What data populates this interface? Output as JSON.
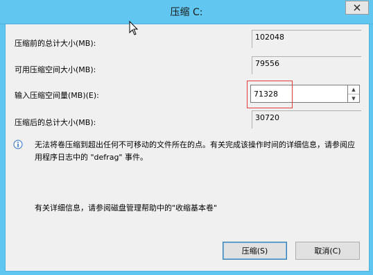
{
  "window": {
    "title": "压缩 C:"
  },
  "fields": {
    "total_before_label": "压缩前的总计大小(MB):",
    "total_before_value": "102048",
    "available_label": "可用压缩空间大小(MB):",
    "available_value": "79556",
    "amount_label": "输入压缩空间量(MB)(E):",
    "amount_value": "71328",
    "total_after_label": "压缩后的总计大小(MB):",
    "total_after_value": "30720"
  },
  "info": {
    "message": "无法将卷压缩到超出任何不可移动的文件所在的点。有关完成该操作时间的详细信息，请参阅应用程序日志中的 \"defrag\" 事件。",
    "help": "有关详细信息，请参阅磁盘管理帮助中的\"收缩基本卷\""
  },
  "buttons": {
    "shrink": "压缩(S)",
    "cancel": "取消(C)"
  },
  "icons": {
    "close": "close-icon",
    "info": "info-icon",
    "spin_up": "spin-up-icon",
    "spin_down": "spin-down-icon",
    "cursor": "mouse-cursor-icon"
  },
  "colors": {
    "title_bar": "#61c7f1",
    "highlight": "#e03a3a",
    "info_icon": "#2a6fc9"
  }
}
